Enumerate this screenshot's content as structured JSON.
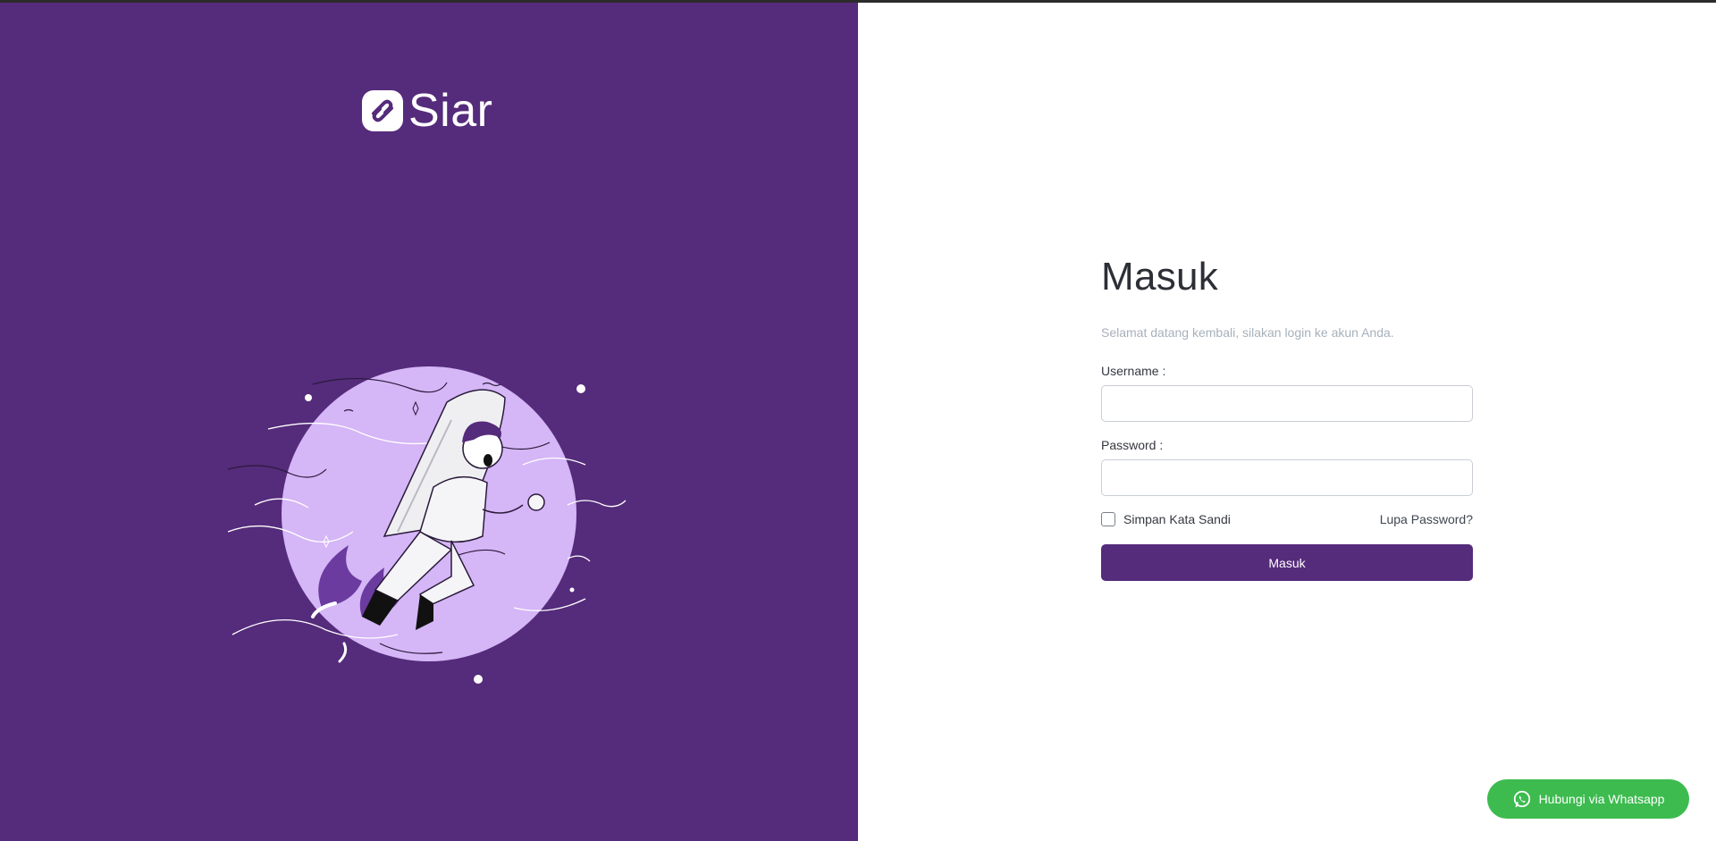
{
  "brand": {
    "name": "Siar",
    "logo_icon": "siar-logo-icon",
    "primary_color": "#552b7b",
    "illustration_icon": "rocket-man-illustration"
  },
  "login": {
    "title": "Masuk",
    "subtitle": "Selamat datang kembali, silakan login ke akun Anda.",
    "username_label": "Username",
    "username_colon": ":",
    "username_value": "",
    "password_label": "Password",
    "password_colon": ":",
    "password_value": "",
    "remember_label": "Simpan Kata Sandi",
    "remember_checked": false,
    "forgot_label": "Lupa Password?",
    "submit_label": "Masuk"
  },
  "whatsapp": {
    "label": "Hubungi via Whatsapp",
    "icon": "whatsapp-icon",
    "color": "#3dbb4f"
  }
}
